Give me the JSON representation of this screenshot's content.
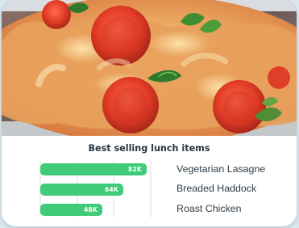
{
  "chart_data": {
    "type": "bar",
    "orientation": "horizontal",
    "title": "Best selling lunch items",
    "categories": [
      "Vegetarian Lasagne",
      "Breaded Haddock",
      "Roast Chicken"
    ],
    "values": [
      82000,
      64000,
      48000
    ],
    "data_labels": [
      "82K",
      "64K",
      "48K"
    ],
    "xlabel": "",
    "ylabel": "",
    "xlim": [
      0,
      85000
    ],
    "grid": true,
    "color": "#3fcb78"
  },
  "card": {
    "image_alt": "",
    "image_subject": "pizza-photo"
  }
}
